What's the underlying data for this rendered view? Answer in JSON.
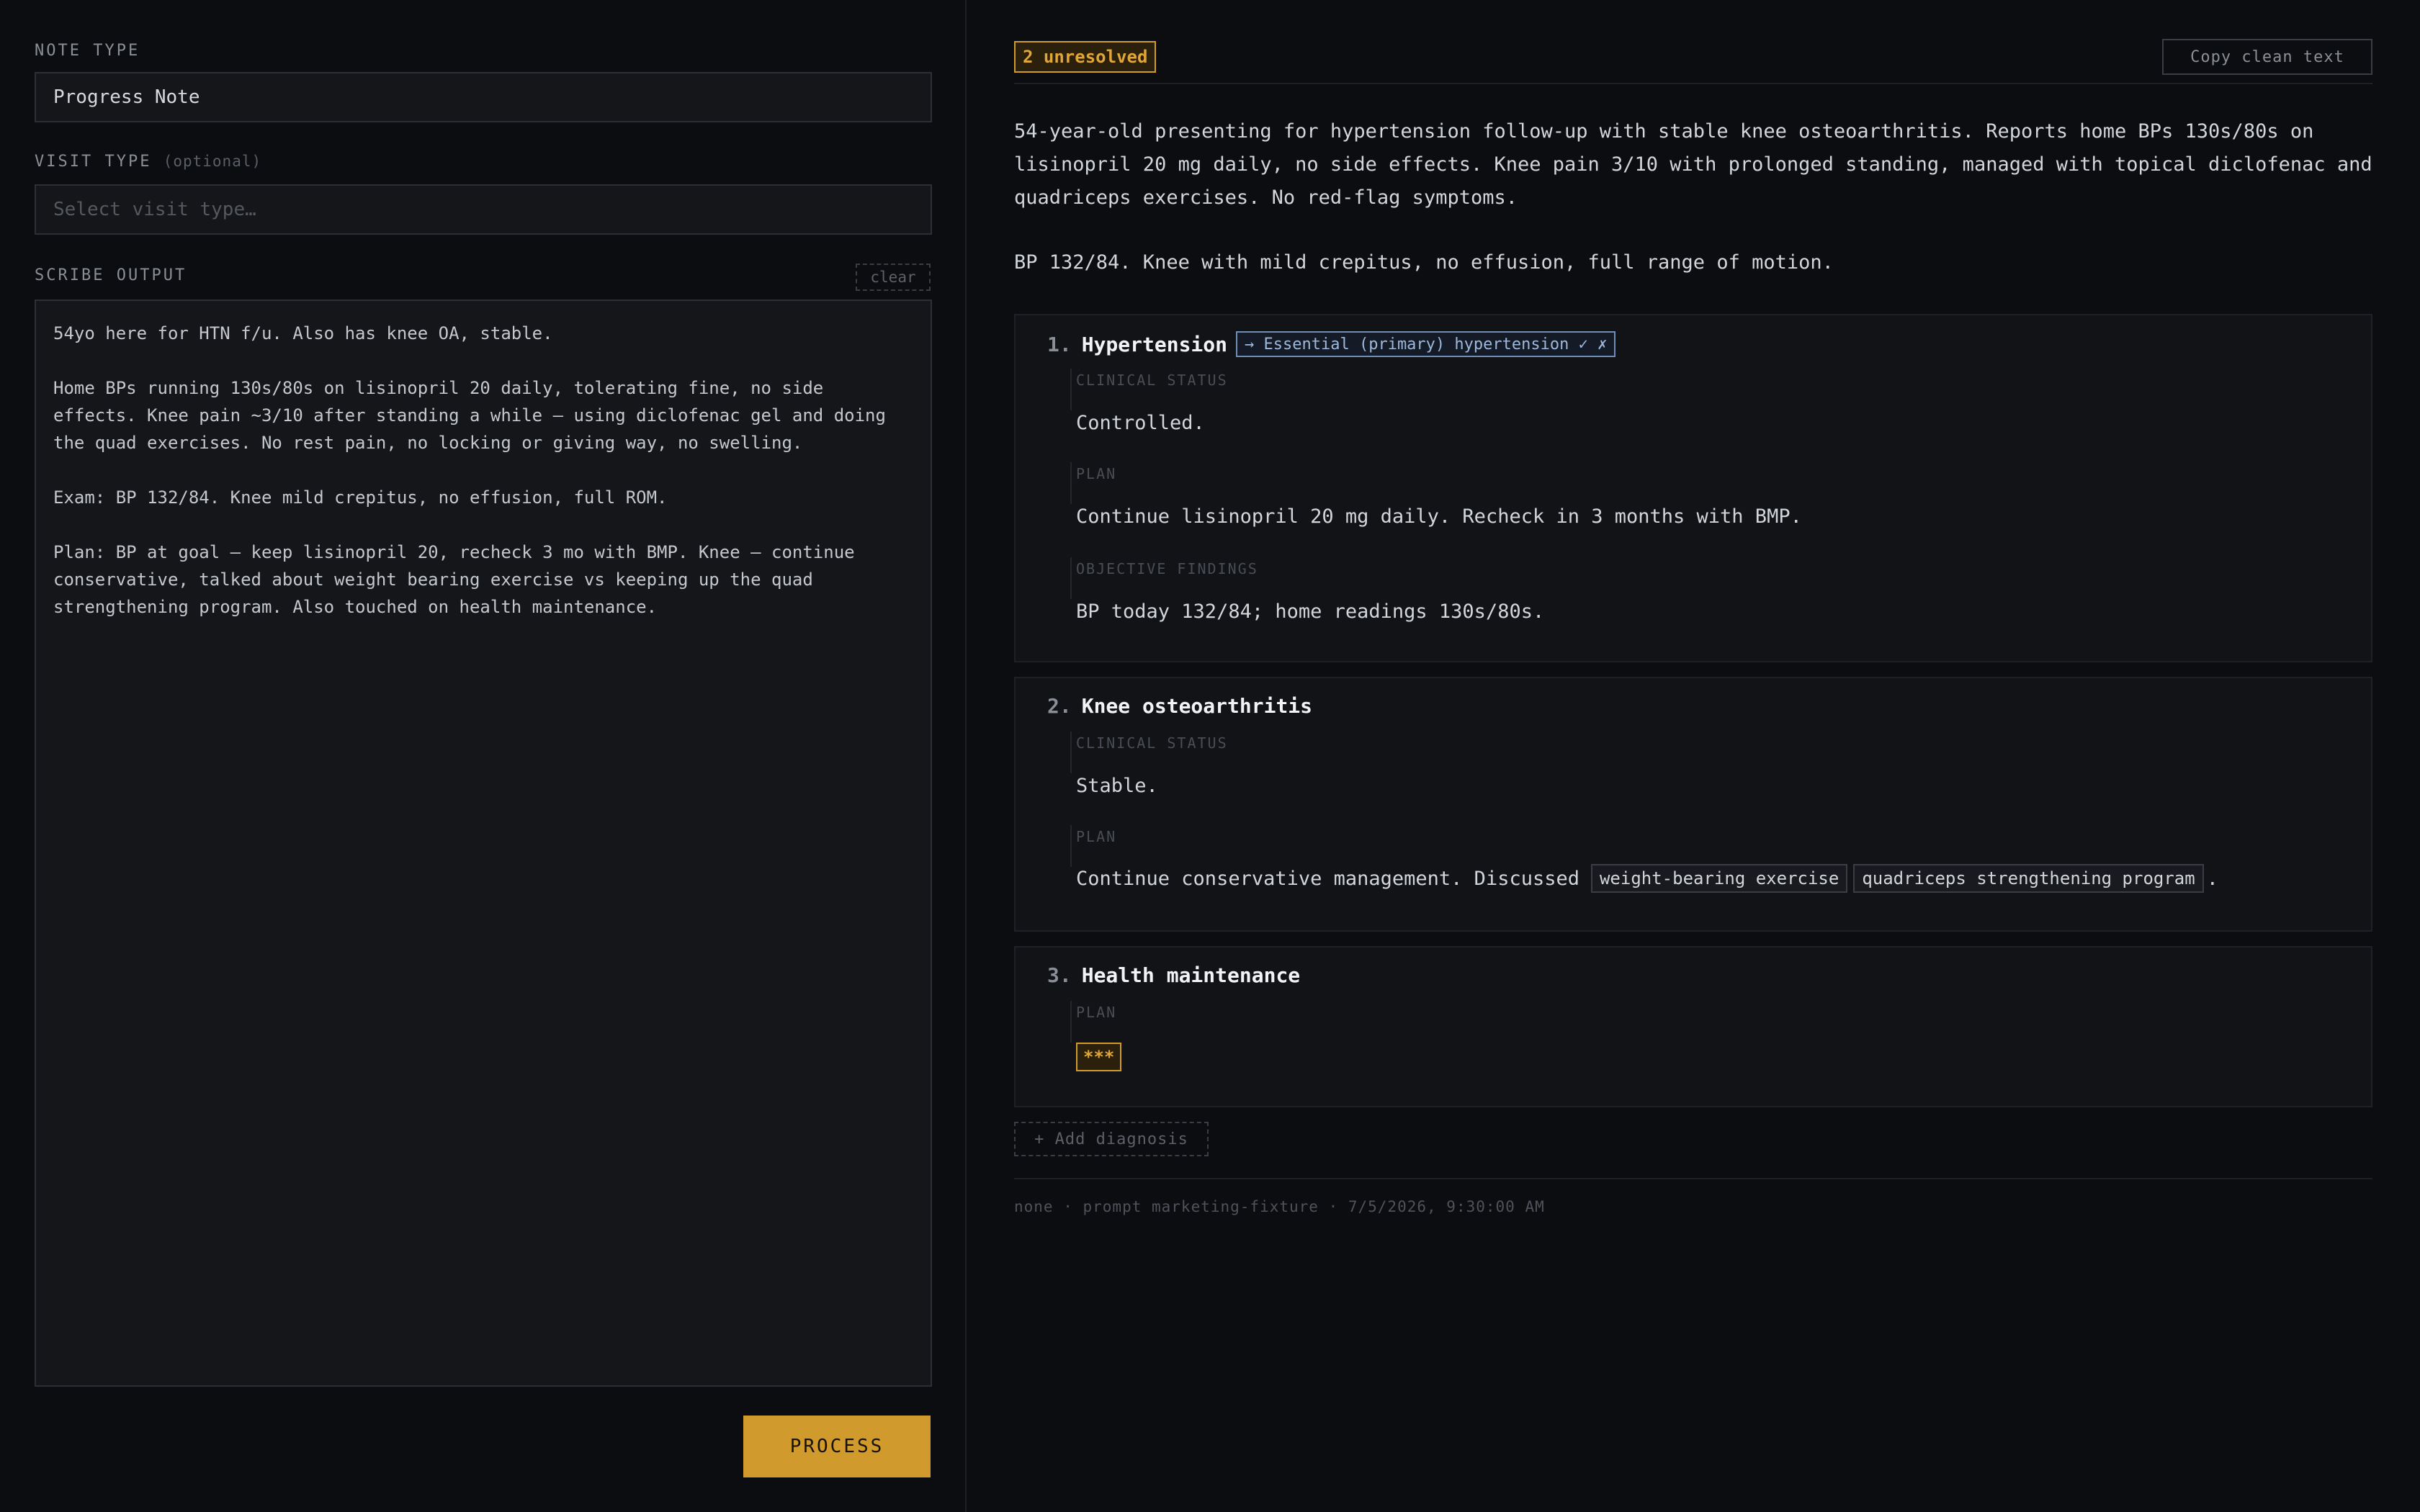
{
  "left": {
    "note_type_label": "NOTE TYPE",
    "note_type_value": "Progress Note",
    "visit_type_label": "VISIT TYPE",
    "visit_type_optional": "(optional)",
    "visit_type_placeholder": "Select visit type…",
    "scribe_label": "SCRIBE OUTPUT",
    "clear_label": "clear",
    "scribe_paragraphs": [
      "54yo here for HTN f/u. Also has knee OA, stable.",
      "Home BPs running 130s/80s on lisinopril 20 daily, tolerating fine, no side effects. Knee pain ~3/10 after standing a while — using diclofenac gel and doing the quad exercises. No rest pain, no locking or giving way, no swelling.",
      "Exam: BP 132/84. Knee mild crepitus, no effusion, full ROM.",
      "Plan: BP at goal — keep lisinopril 20, recheck 3 mo with BMP. Knee — continue conservative, talked about weight bearing exercise vs keeping up the quad strengthening program. Also touched on health maintenance."
    ],
    "process_label": "PROCESS"
  },
  "right": {
    "unresolved_badge": "2 unresolved",
    "copy_label": "Copy clean text",
    "summary_1": "54-year-old presenting for hypertension follow-up with stable knee osteoarthritis. Reports home BPs 130s/80s on lisinopril 20 mg daily, no side effects. Knee pain 3/10 with prolonged standing, managed with topical diclofenac and quadriceps exercises. No red-flag symptoms.",
    "summary_2": "BP 132/84. Knee with mild crepitus, no effusion, full range of motion.",
    "diagnoses": [
      {
        "num": "1.",
        "title": "Hypertension",
        "code_tag": "→ Essential (primary) hypertension ✓ ✗",
        "sections": [
          {
            "label": "CLINICAL STATUS",
            "text": "Controlled."
          },
          {
            "label": "PLAN",
            "text": "Continue lisinopril 20 mg daily. Recheck in 3 months with BMP."
          },
          {
            "label": "OBJECTIVE FINDINGS",
            "text": "BP today 132/84; home readings 130s/80s."
          }
        ]
      },
      {
        "num": "2.",
        "title": "Knee osteoarthritis",
        "sections": [
          {
            "label": "CLINICAL STATUS",
            "text": "Stable."
          },
          {
            "label": "PLAN",
            "text_prefix": "Continue conservative management. Discussed",
            "chips": [
              "weight-bearing exercise",
              "quadriceps strengthening program"
            ],
            "text_suffix": "."
          }
        ]
      },
      {
        "num": "3.",
        "title": "Health maintenance",
        "sections": [
          {
            "label": "PLAN",
            "unresolved": "***"
          }
        ]
      }
    ],
    "add_diagnosis_label": "+ Add diagnosis",
    "footer_meta": "none · prompt marketing-fixture · 7/5/2026, 9:30:00 AM"
  }
}
